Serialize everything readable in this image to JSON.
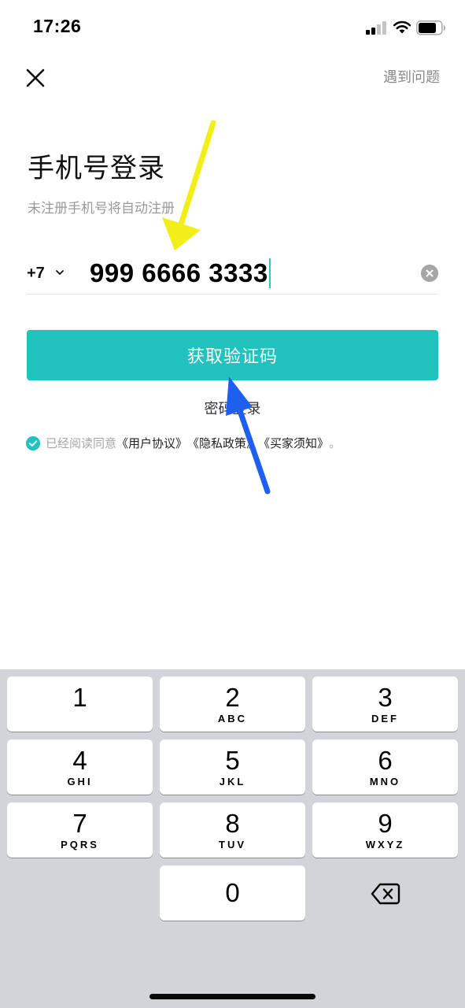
{
  "status_bar": {
    "time": "17:26"
  },
  "header": {
    "help_label": "遇到问题"
  },
  "login": {
    "title": "手机号登录",
    "subtitle": "未注册手机号将自动注册",
    "country_code": "+7",
    "phone_value": "999 6666 3333",
    "get_code_label": "获取验证码",
    "password_login_label": "密码登录"
  },
  "agreement": {
    "prefix": "已经阅读同意",
    "user_agreement": "《用户协议》",
    "privacy_policy": "《隐私政策》",
    "buyer_notice": "《买家须知》",
    "suffix": "。"
  },
  "keyboard": {
    "keys": [
      {
        "digit": "1",
        "letters": ""
      },
      {
        "digit": "2",
        "letters": "ABC"
      },
      {
        "digit": "3",
        "letters": "DEF"
      },
      {
        "digit": "4",
        "letters": "GHI"
      },
      {
        "digit": "5",
        "letters": "JKL"
      },
      {
        "digit": "6",
        "letters": "MNO"
      },
      {
        "digit": "7",
        "letters": "PQRS"
      },
      {
        "digit": "8",
        "letters": "TUV"
      },
      {
        "digit": "9",
        "letters": "WXYZ"
      },
      {
        "digit": "0",
        "letters": ""
      }
    ]
  },
  "colors": {
    "accent": "#22c2bf",
    "annotation_yellow": "#f2ee18",
    "annotation_blue": "#1f5ff0",
    "keyboard_bg": "#d2d4d9"
  },
  "icons": [
    "close-icon",
    "chevron-down-icon",
    "clear-icon",
    "check-circle-icon",
    "delete-icon",
    "signal-icon",
    "wifi-icon",
    "battery-icon"
  ]
}
